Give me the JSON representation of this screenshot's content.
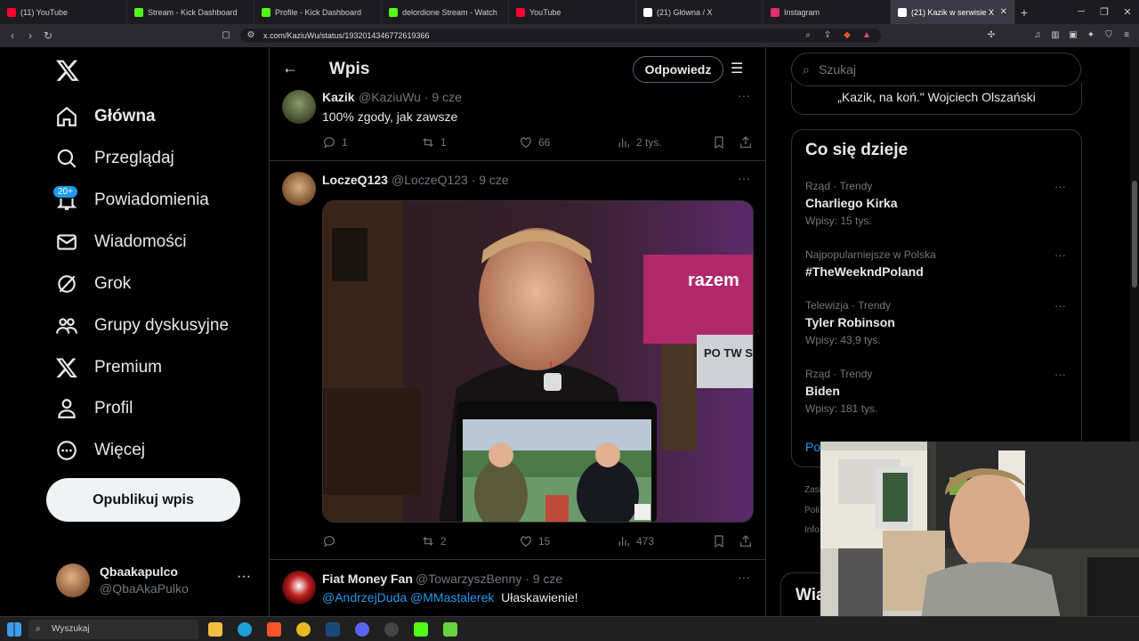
{
  "browser": {
    "tabs": [
      {
        "title": "(11) YouTube",
        "color": "#ff0033"
      },
      {
        "title": "Stream - Kick Dashboard",
        "color": "#53fc18"
      },
      {
        "title": "Profile - Kick Dashboard",
        "color": "#53fc18"
      },
      {
        "title": "delordione Stream - Watch",
        "color": "#53fc18"
      },
      {
        "title": "YouTube",
        "color": "#ff0033"
      },
      {
        "title": "(21) Główna / X",
        "color": "#ffffff"
      },
      {
        "title": "Instagram",
        "color": "#e1306c"
      },
      {
        "title": "(21) Kazik w serwisie X",
        "color": "#ffffff"
      }
    ],
    "url": "x.com/KaziuWu/status/1932014346772619366"
  },
  "nav": {
    "items": [
      "Główna",
      "Przeglądaj",
      "Powiadomienia",
      "Wiadomości",
      "Grok",
      "Grupy dyskusyjne",
      "Premium",
      "Profil",
      "Więcej"
    ],
    "badge": "20+",
    "publish": "Opublikuj wpis"
  },
  "account": {
    "name": "Qbaakapulco",
    "handle": "@QbaAkaPulko"
  },
  "header": {
    "title": "Wpis",
    "reply": "Odpowiedz"
  },
  "tweets": [
    {
      "name": "Kazik",
      "handle": "@KaziuWu · 9 cze",
      "text": "100% zgody, jak zawsze",
      "replies": "1",
      "reposts": "1",
      "likes": "66",
      "views": "2 tys."
    },
    {
      "name": "LoczeQ123",
      "handle": "@LoczeQ123 · 9 cze",
      "text": "",
      "replies": "",
      "reposts": "2",
      "likes": "15",
      "views": "473",
      "media_text": {
        "sign": "razem",
        "poster": "PO TW STRO"
      }
    },
    {
      "name": "Fiat Money Fan",
      "handle": "@TowarzyszBenny · 9 cze",
      "mentions": "@AndrzejDuda @MMastalerek",
      "text": "Ułaskawienie!"
    }
  ],
  "right": {
    "search_placeholder": "Szukaj",
    "quote": "„Kazik, na koń.\" Wojciech Olszański",
    "trends_title": "Co się dzieje",
    "trends": [
      {
        "category": "Rząd · Trendy",
        "name": "Charliego Kirka",
        "posts": "Wpisy: 15 tys."
      },
      {
        "category": "Najpopularniejsze w Polska",
        "name": "#TheWeekndPoland",
        "posts": ""
      },
      {
        "category": "Telewizja · Trendy",
        "name": "Tyler Robinson",
        "posts": "Wpisy: 43,9 tys."
      },
      {
        "category": "Rząd · Trendy",
        "name": "Biden",
        "posts": "Wpisy: 181 tys."
      }
    ],
    "show_more": "Po",
    "footer_partial": [
      "Zasi",
      "Poli",
      "Info"
    ],
    "partial_heading": "Wia"
  },
  "taskbar": {
    "search": "Wyszukaj"
  }
}
